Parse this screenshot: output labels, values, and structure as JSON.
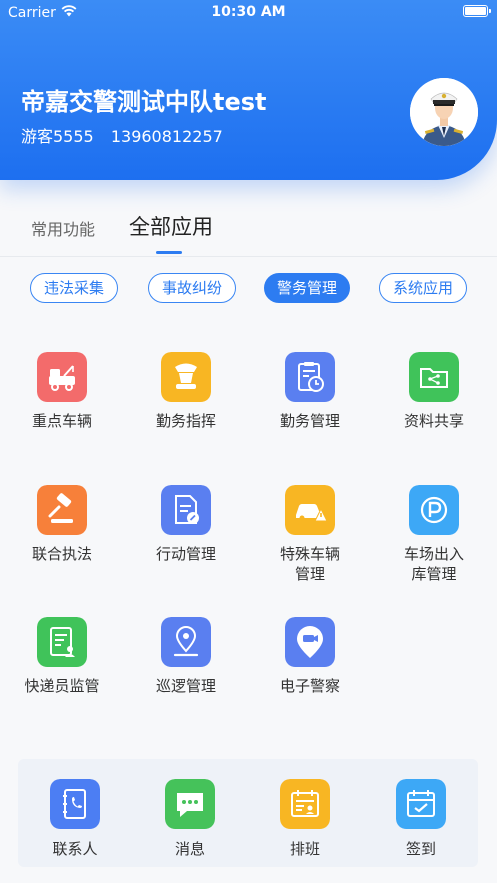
{
  "status_bar": {
    "carrier": "Carrier",
    "time": "10:30 AM"
  },
  "header": {
    "unit_name": "帝嘉交警测试中队test",
    "user_name": "游客5555",
    "phone": "13960812257"
  },
  "tabs": {
    "common": "常用功能",
    "all": "全部应用"
  },
  "categories": [
    {
      "label": "违法采集"
    },
    {
      "label": "事故纠纷"
    },
    {
      "label": "警务管理",
      "active": true
    },
    {
      "label": "系统应用"
    }
  ],
  "apps": [
    {
      "label": "重点车辆",
      "icon": "tow-truck-icon",
      "color": "#f36b6b"
    },
    {
      "label": "勤务指挥",
      "icon": "officer-hat-icon",
      "color": "#f8b623"
    },
    {
      "label": "勤务管理",
      "icon": "clipboard-clock-icon",
      "color": "#5a7ff0"
    },
    {
      "label": "资料共享",
      "icon": "folder-share-icon",
      "color": "#40c35a"
    },
    {
      "label": "联合执法",
      "icon": "gavel-icon",
      "color": "#f7803a"
    },
    {
      "label": "行动管理",
      "icon": "document-edit-icon",
      "color": "#5a7ff0"
    },
    {
      "label": "特殊车辆\n管理",
      "icon": "car-warning-icon",
      "color": "#f8b623"
    },
    {
      "label": "车场出入\n库管理",
      "icon": "parking-icon",
      "color": "#3da8f6"
    },
    {
      "label": "快递员监管",
      "icon": "courier-doc-icon",
      "color": "#40c35a"
    },
    {
      "label": "巡逻管理",
      "icon": "location-pin-icon",
      "color": "#5a7ff0"
    },
    {
      "label": "电子警察",
      "icon": "camera-pin-icon",
      "color": "#5a7ff0"
    }
  ],
  "dock": [
    {
      "label": "联系人",
      "icon": "contacts-book-icon",
      "color": "#4c7ef3"
    },
    {
      "label": "消息",
      "icon": "chat-bubble-icon",
      "color": "#45c25a"
    },
    {
      "label": "排班",
      "icon": "schedule-badge-icon",
      "color": "#f8b623"
    },
    {
      "label": "签到",
      "icon": "calendar-check-icon",
      "color": "#3da8f6"
    }
  ]
}
